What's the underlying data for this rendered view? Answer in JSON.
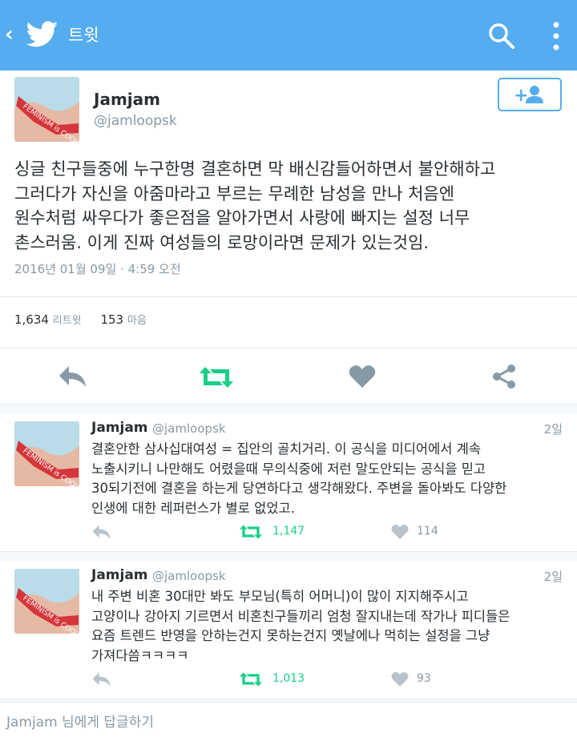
{
  "header": {
    "title": "트윗"
  },
  "tweet": {
    "name": "Jamjam",
    "handle": "@jamloopsk",
    "text": "싱글 친구들중에 누구한명 결혼하면 막 배신감들어하면서 불안해하고\n그러다가 자신을 아줌마라고 부르는 무례한 남성을 만나 처음엔\n원수처럼 싸우다가 좋은점을 알아가면서 사랑에 빠지는 설정 너무\n촌스러움. 이게 진짜 여성들의 로망이라면 문제가 있는것임.",
    "timestamp": "2016년 01월 09일 · 4:59 오전",
    "retweets": "1,634",
    "retweets_label": "리트윗",
    "likes": "153",
    "likes_label": "마음"
  },
  "avatar_text": "FEMINISM is COOL",
  "replies": [
    {
      "name": "Jamjam",
      "handle": "@jamloopsk",
      "date": "2일",
      "text": "결혼안한 삼사십대여성 = 집안의 골치거리. 이 공식을 미디어에서 계속\n노출시키니 나만해도 어렸을때 무의식중에 저런 말도안되는 공식을 믿고\n30되기전에 결혼을 하는게 당연하다고 생각해왔다. 주변을 돌아봐도 다양한\n인생에 대한 레퍼런스가 별로 없었고.",
      "retweets": "1,147",
      "likes": "114"
    },
    {
      "name": "Jamjam",
      "handle": "@jamloopsk",
      "date": "2일",
      "text": "내 주변 비혼 30대만 봐도 부모님(특히 어머니)이 많이 지지해주시고\n고양이나 강아지 기르면서 비혼친구들끼리 엄청 잘지내는데 작가나 피디들은\n요즘 트렌드 반영을 안하는건지 못하는건지 옛날에나 먹히는 설정을 그냥\n가져다씀ㅋㅋㅋㅋ",
      "retweets": "1,013",
      "likes": "93"
    }
  ],
  "reply_bar": {
    "placeholder": "Jamjam 님에게 답글하기"
  },
  "colors": {
    "brand": "#55acee",
    "retweet": "#19cf86",
    "icon_gray": "#8899a6",
    "avatar_ribbon": "#d4363b"
  }
}
